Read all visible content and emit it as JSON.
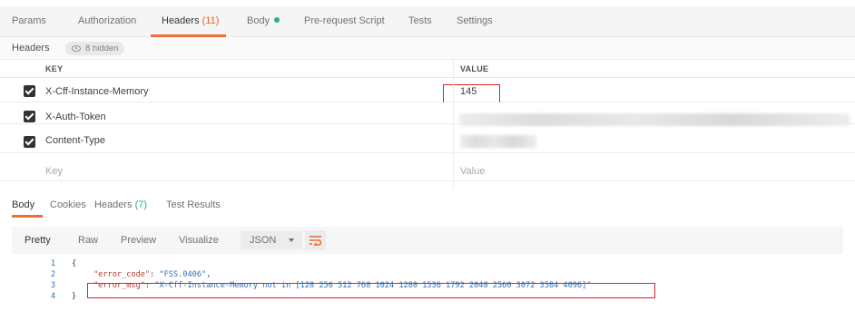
{
  "request_tabs": {
    "params": "Params",
    "authorization": "Authorization",
    "headers_label": "Headers",
    "headers_count": "(11)",
    "body": "Body",
    "pre_request": "Pre-request Script",
    "tests": "Tests",
    "settings": "Settings"
  },
  "headers_section": {
    "title": "Headers",
    "hidden_label": "8 hidden",
    "key_column": "KEY",
    "value_column": "VALUE",
    "rows": [
      {
        "key": "X-Cff-Instance-Memory",
        "value": "145",
        "checked": true
      },
      {
        "key": "X-Auth-Token",
        "value": "",
        "checked": true
      },
      {
        "key": "Content-Type",
        "value": "",
        "checked": true
      }
    ],
    "new_key_placeholder": "Key",
    "new_value_placeholder": "Value"
  },
  "response_tabs": {
    "body": "Body",
    "cookies": "Cookies",
    "headers_label": "Headers",
    "headers_count": "(7)",
    "test_results": "Test Results"
  },
  "response_toolbar": {
    "pretty": "Pretty",
    "raw": "Raw",
    "preview": "Preview",
    "visualize": "Visualize",
    "format": "JSON"
  },
  "response_body": {
    "line_numbers": [
      "1",
      "2",
      "3",
      "4"
    ],
    "open_brace": "{",
    "close_brace": "}",
    "error_code_key": "\"error_code\"",
    "error_code_value": "\"FSS.0406\"",
    "error_msg_key": "\"error_msg\"",
    "error_msg_value": "\"X-Cff-Instance-Memory not in [128 256 512 768 1024 1280 1536 1792 2048 2560 3072 3584 4096]\""
  },
  "colors": {
    "accent": "#f26b3a",
    "success": "#26b47f",
    "highlight_box": "#e02020"
  }
}
